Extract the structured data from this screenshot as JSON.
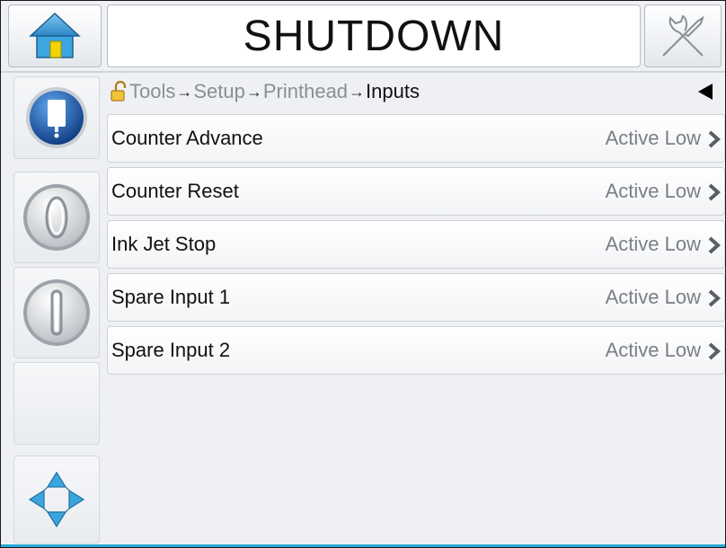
{
  "header": {
    "title": "SHUTDOWN",
    "home_icon": "home-icon",
    "tools_icon": "tools-icon"
  },
  "sidebar": {
    "buttons": [
      {
        "icon": "ink-system-icon",
        "color": "#1f5fb4"
      },
      {
        "icon": "jet-off-icon"
      },
      {
        "icon": "jet-on-icon"
      },
      {
        "icon": "blank"
      },
      {
        "icon": "navigation-arrows-icon",
        "color": "#3aa6dc"
      }
    ]
  },
  "breadcrumb": {
    "lock_icon": "unlock-icon",
    "items": [
      "Tools",
      "Setup",
      "Printhead",
      "Inputs"
    ],
    "separator": "→"
  },
  "inputs": [
    {
      "label": "Counter Advance",
      "value": "Active Low"
    },
    {
      "label": "Counter Reset",
      "value": "Active Low"
    },
    {
      "label": "Ink Jet Stop",
      "value": "Active Low"
    },
    {
      "label": "Spare Input 1",
      "value": "Active Low"
    },
    {
      "label": "Spare Input 2",
      "value": "Active Low"
    }
  ],
  "colors": {
    "accent": "#2aa8d8",
    "chevron": "#5a5f66"
  }
}
